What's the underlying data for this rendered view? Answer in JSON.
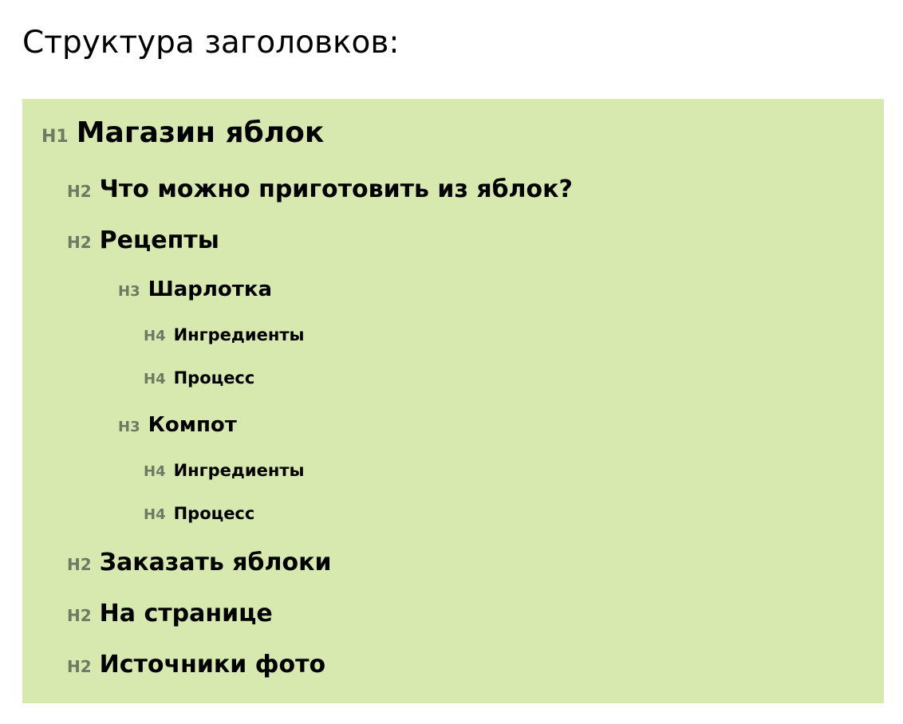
{
  "page_title": "Структура заголовков:",
  "accent_color": "#d8e9b0",
  "tag_color": "#6f7a63",
  "outline": [
    {
      "tag": "H1",
      "text": "Магазин яблок"
    },
    {
      "tag": "H2",
      "text": "Что можно приготовить из яблок?"
    },
    {
      "tag": "H2",
      "text": "Рецепты"
    },
    {
      "tag": "H3",
      "text": "Шарлотка"
    },
    {
      "tag": "H4",
      "text": "Ингредиенты"
    },
    {
      "tag": "H4",
      "text": "Процесс"
    },
    {
      "tag": "H3",
      "text": "Компот"
    },
    {
      "tag": "H4",
      "text": "Ингредиенты"
    },
    {
      "tag": "H4",
      "text": "Процесс"
    },
    {
      "tag": "H2",
      "text": "Заказать яблоки"
    },
    {
      "tag": "H2",
      "text": "На странице"
    },
    {
      "tag": "H2",
      "text": "Источники фото"
    }
  ]
}
